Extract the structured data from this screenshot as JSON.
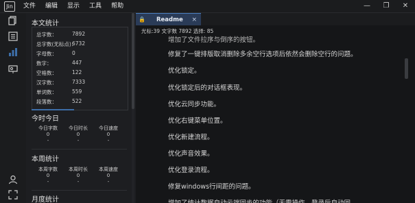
{
  "app": {
    "logo_text": "Jin",
    "menu": [
      "文件",
      "编辑",
      "显示",
      "工具",
      "帮助"
    ],
    "window_controls": [
      "minimize-icon",
      "restore-icon",
      "close-icon"
    ]
  },
  "activity_bar": {
    "icons": [
      "files-icon",
      "outline-icon",
      "stats-icon",
      "preview-icon",
      "user-icon",
      "fullscreen-icon"
    ]
  },
  "sidebar": {
    "total": {
      "title": "本文统计",
      "rows": [
        {
          "label": "总字数：",
          "value": "7892"
        },
        {
          "label": "总字数(无标点)：",
          "value": "6732"
        },
        {
          "label": "字母数：",
          "value": "0"
        },
        {
          "label": "数字：",
          "value": "447"
        },
        {
          "label": "空格数：",
          "value": "122"
        },
        {
          "label": "汉字数：",
          "value": "7333"
        },
        {
          "label": "单词数：",
          "value": "559"
        },
        {
          "label": "段落数：",
          "value": "522"
        }
      ]
    },
    "today": {
      "title": "今时今日",
      "headers": [
        "今日字数",
        "今日时长",
        "今日速度"
      ],
      "values": [
        "0",
        "0",
        "0"
      ],
      "extras": [
        "-",
        "-",
        "-"
      ]
    },
    "week": {
      "title": "本周统计",
      "headers": [
        "本周字数",
        "本周时长",
        "本周速度"
      ],
      "values": [
        "0",
        "0",
        "0"
      ],
      "extras": [
        "-",
        "-",
        "-"
      ]
    },
    "month": {
      "title": "月度统计"
    }
  },
  "editor": {
    "tab": {
      "name": "Readme",
      "close": "×"
    },
    "status": "光标:39  文字数 7892  选择: 85",
    "lines": [
      "增加了文件拉序与倒序的按钮。",
      "修复了一键排版取消删除多余空行选项后依然会删除空行的问题。",
      "优化锁定。",
      "优化锁定后的对话框表现。",
      "优化云同步功能。",
      "优化右键菜单位置。",
      "优化新建流程。",
      "优化声音效果。",
      "优化登录流程。",
      "修复windows行间距的问题。",
      "增加了统计数据自动云端同步的功能（无需操作，登录后自动同"
    ]
  }
}
